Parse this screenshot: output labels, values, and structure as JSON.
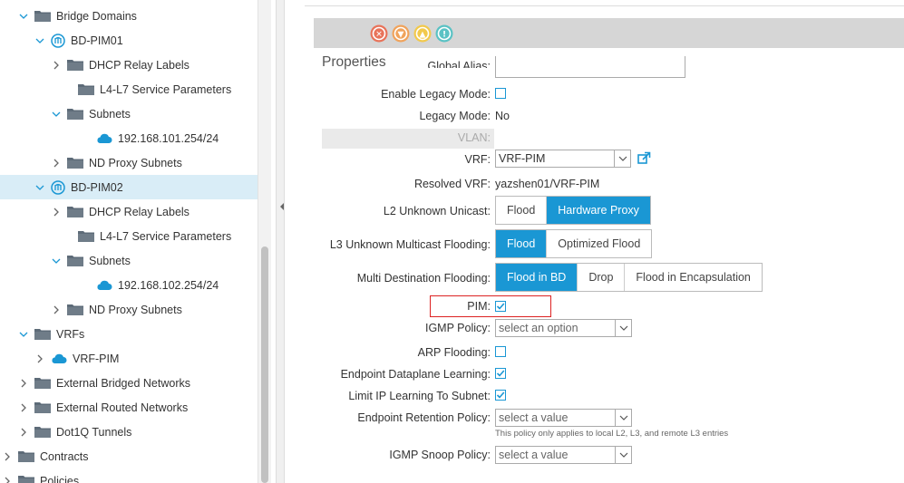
{
  "tree": {
    "items": [
      {
        "label": "Bridge Domains",
        "icon": "folder-icon",
        "chevron": "down"
      },
      {
        "label": "BD-PIM01",
        "icon": "bridge-domain-icon",
        "chevron": "down"
      },
      {
        "label": "DHCP Relay Labels",
        "icon": "folder-icon",
        "chevron": "right"
      },
      {
        "label": "L4-L7 Service Parameters",
        "icon": "folder-icon",
        "chevron": ""
      },
      {
        "label": "Subnets",
        "icon": "folder-icon",
        "chevron": "down"
      },
      {
        "label": "192.168.101.254/24",
        "icon": "cloud-icon",
        "chevron": ""
      },
      {
        "label": "ND Proxy Subnets",
        "icon": "folder-icon",
        "chevron": "right"
      },
      {
        "label": "BD-PIM02",
        "icon": "bridge-domain-icon",
        "chevron": "down"
      },
      {
        "label": "DHCP Relay Labels",
        "icon": "folder-icon",
        "chevron": "right"
      },
      {
        "label": "L4-L7 Service Parameters",
        "icon": "folder-icon",
        "chevron": ""
      },
      {
        "label": "Subnets",
        "icon": "folder-icon",
        "chevron": "down"
      },
      {
        "label": "192.168.102.254/24",
        "icon": "cloud-icon",
        "chevron": ""
      },
      {
        "label": "ND Proxy Subnets",
        "icon": "folder-icon",
        "chevron": "right"
      },
      {
        "label": "VRFs",
        "icon": "folder-icon",
        "chevron": "down"
      },
      {
        "label": "VRF-PIM",
        "icon": "cloud-icon",
        "chevron": "right"
      },
      {
        "label": "External Bridged Networks",
        "icon": "folder-icon",
        "chevron": "right"
      },
      {
        "label": "External Routed Networks",
        "icon": "folder-icon",
        "chevron": "right"
      },
      {
        "label": "Dot1Q Tunnels",
        "icon": "folder-icon",
        "chevron": "right"
      },
      {
        "label": "Contracts",
        "icon": "folder-icon",
        "chevron": "right"
      },
      {
        "label": "Policies",
        "icon": "folder-icon",
        "chevron": "right"
      }
    ]
  },
  "fault_icons": [
    {
      "name": "critical-fault-icon",
      "color": "#e8735a",
      "glyph": "✕"
    },
    {
      "name": "major-fault-icon",
      "color": "#f0a35c",
      "glyph": "▼"
    },
    {
      "name": "minor-fault-icon",
      "color": "#f2c94c",
      "glyph": "▲"
    },
    {
      "name": "warning-fault-icon",
      "color": "#5ac2c4",
      "glyph": "!"
    }
  ],
  "properties": {
    "title": "Properties",
    "global_alias_label": "Global Alias:",
    "enable_legacy_mode_label": "Enable Legacy Mode:",
    "legacy_mode_label": "Legacy Mode:",
    "legacy_mode_value": "No",
    "vlan_label": "VLAN:",
    "vrf_label": "VRF:",
    "vrf_value": "VRF-PIM",
    "resolved_vrf_label": "Resolved VRF:",
    "resolved_vrf_value": "yazshen01/VRF-PIM",
    "l2_unknown_unicast_label": "L2 Unknown Unicast:",
    "l2_options": [
      "Flood",
      "Hardware Proxy"
    ],
    "l3_unknown_multicast_label": "L3 Unknown Multicast Flooding:",
    "l3_options": [
      "Flood",
      "Optimized Flood"
    ],
    "multi_dest_label": "Multi Destination Flooding:",
    "multi_dest_options": [
      "Flood in BD",
      "Drop",
      "Flood in Encapsulation"
    ],
    "pim_label": "PIM:",
    "igmp_policy_label": "IGMP Policy:",
    "igmp_policy_placeholder": "select an option",
    "arp_flooding_label": "ARP Flooding:",
    "endpoint_dataplane_label": "Endpoint Dataplane Learning:",
    "limit_ip_label": "Limit IP Learning To Subnet:",
    "endpoint_retention_label": "Endpoint Retention Policy:",
    "endpoint_retention_placeholder": "select a value",
    "endpoint_retention_hint": "This policy only applies to local L2, L3, and remote L3 entries",
    "igmp_snoop_label": "IGMP Snoop Policy:",
    "igmp_snoop_placeholder": "select a value"
  },
  "state": {
    "enable_legacy_mode": false,
    "pim": true,
    "arp_flooding": false,
    "endpoint_dataplane_learning": true,
    "limit_ip_learning": true,
    "l2_selected": 1,
    "l3_selected": 0,
    "multi_dest_selected": 0
  },
  "colors": {
    "accent": "#1a97d4",
    "highlight": "#d22222",
    "selected_row": "#d9edf7"
  }
}
